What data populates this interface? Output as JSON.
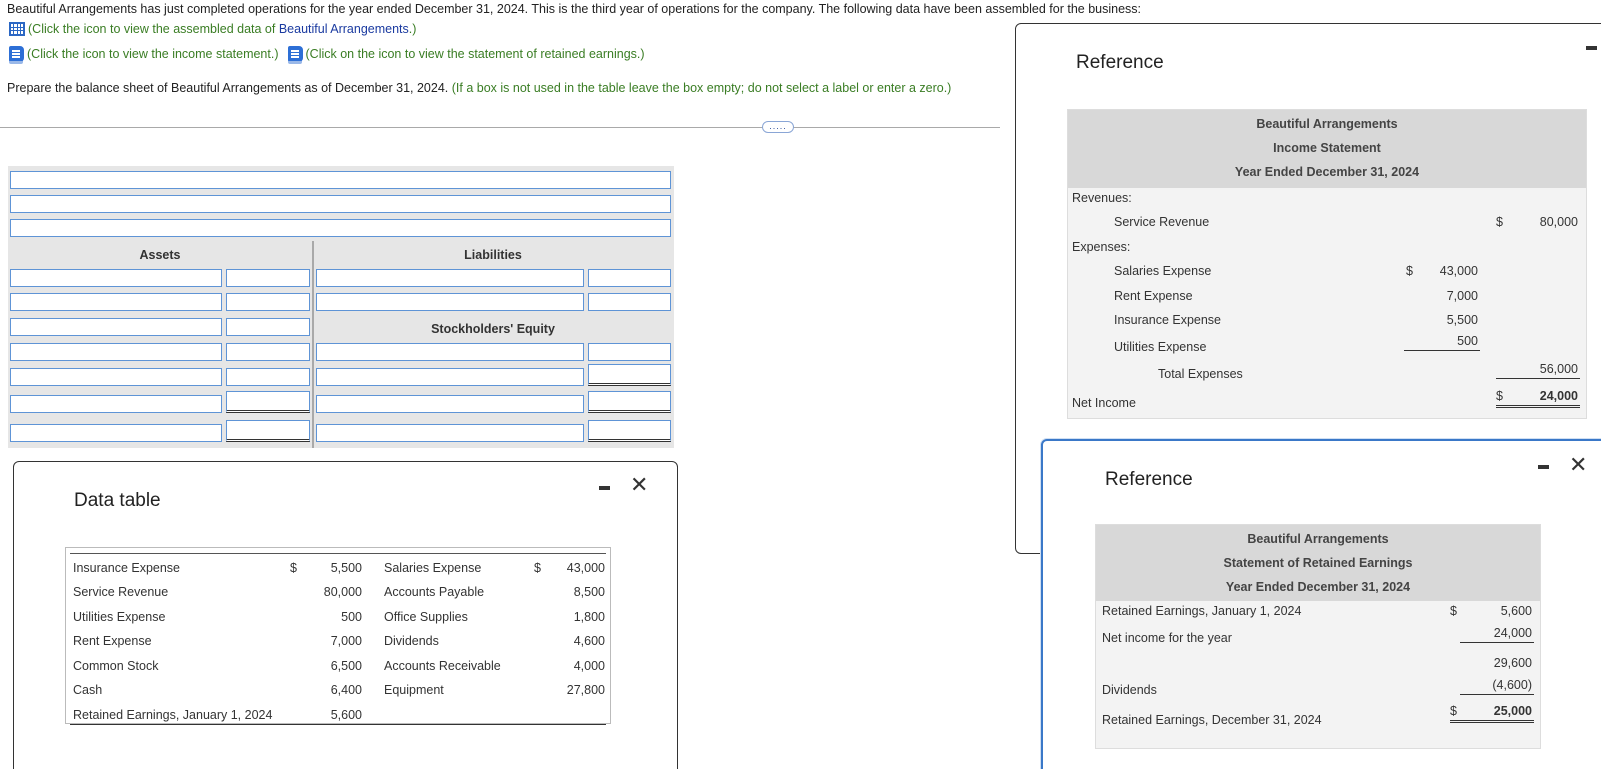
{
  "header": {
    "intro": "Beautiful Arrangements has just completed operations for the year ended December 31, 2024. This is the third year of operations for the company. The following data have been assembled for the business:",
    "link_data_pre": "(Click the icon to view the assembled data of ",
    "link_data_company": "Beautiful Arrangements",
    "link_data_post": ".)",
    "link_income": "(Click the icon to view the income statement.)",
    "link_retained": "(Click on the icon to view the statement of retained earnings.)",
    "instruction": "Prepare the balance sheet of Beautiful Arrangements as of December 31, 2024.",
    "instruction_note": "(If a box is not used in the table leave the box empty; do not select a label or enter a zero.)",
    "more_button": "....."
  },
  "balance_sheet": {
    "assets_header": "Assets",
    "liabilities_header": "Liabilities",
    "equity_header": "Stockholders' Equity"
  },
  "data_table": {
    "title": "Data table",
    "rows": [
      {
        "l_label": "Insurance Expense",
        "l_cur": "$",
        "l_val": "5,500",
        "r_label": "Salaries Expense",
        "r_cur": "$",
        "r_val": "43,000"
      },
      {
        "l_label": "Service Revenue",
        "l_cur": "",
        "l_val": "80,000",
        "r_label": "Accounts Payable",
        "r_cur": "",
        "r_val": "8,500"
      },
      {
        "l_label": "Utilities Expense",
        "l_cur": "",
        "l_val": "500",
        "r_label": "Office Supplies",
        "r_cur": "",
        "r_val": "1,800"
      },
      {
        "l_label": "Rent Expense",
        "l_cur": "",
        "l_val": "7,000",
        "r_label": "Dividends",
        "r_cur": "",
        "r_val": "4,600"
      },
      {
        "l_label": "Common Stock",
        "l_cur": "",
        "l_val": "6,500",
        "r_label": "Accounts Receivable",
        "r_cur": "",
        "r_val": "4,000"
      },
      {
        "l_label": "Cash",
        "l_cur": "",
        "l_val": "6,400",
        "r_label": "Equipment",
        "r_cur": "",
        "r_val": "27,800"
      },
      {
        "l_label": "Retained Earnings, January 1, 2024",
        "l_cur": "",
        "l_val": "5,600",
        "r_label": "",
        "r_cur": "",
        "r_val": ""
      }
    ]
  },
  "income_statement": {
    "window_title": "Reference",
    "company": "Beautiful Arrangements",
    "statement": "Income Statement",
    "period": "Year Ended December 31, 2024",
    "revenues_label": "Revenues:",
    "service_revenue_label": "Service Revenue",
    "service_revenue_cur": "$",
    "service_revenue": "80,000",
    "expenses_label": "Expenses:",
    "expenses": [
      {
        "label": "Salaries Expense",
        "cur": "$",
        "value": "43,000"
      },
      {
        "label": "Rent Expense",
        "cur": "",
        "value": "7,000"
      },
      {
        "label": "Insurance Expense",
        "cur": "",
        "value": "5,500"
      },
      {
        "label": "Utilities Expense",
        "cur": "",
        "value": "500"
      }
    ],
    "total_expenses_label": "Total Expenses",
    "total_expenses": "56,000",
    "net_income_label": "Net Income",
    "net_income_cur": "$",
    "net_income": "24,000"
  },
  "retained_earnings": {
    "window_title": "Reference",
    "company": "Beautiful Arrangements",
    "statement": "Statement of Retained Earnings",
    "period": "Year Ended December 31, 2024",
    "beginning_label": "Retained Earnings, January 1, 2024",
    "beginning_cur": "$",
    "beginning": "5,600",
    "net_income_label": "Net income for the year",
    "net_income": "24,000",
    "subtotal": "29,600",
    "dividends_label": "Dividends",
    "dividends": "(4,600)",
    "ending_label": "Retained Earnings, December 31, 2024",
    "ending_cur": "$",
    "ending": "25,000"
  }
}
